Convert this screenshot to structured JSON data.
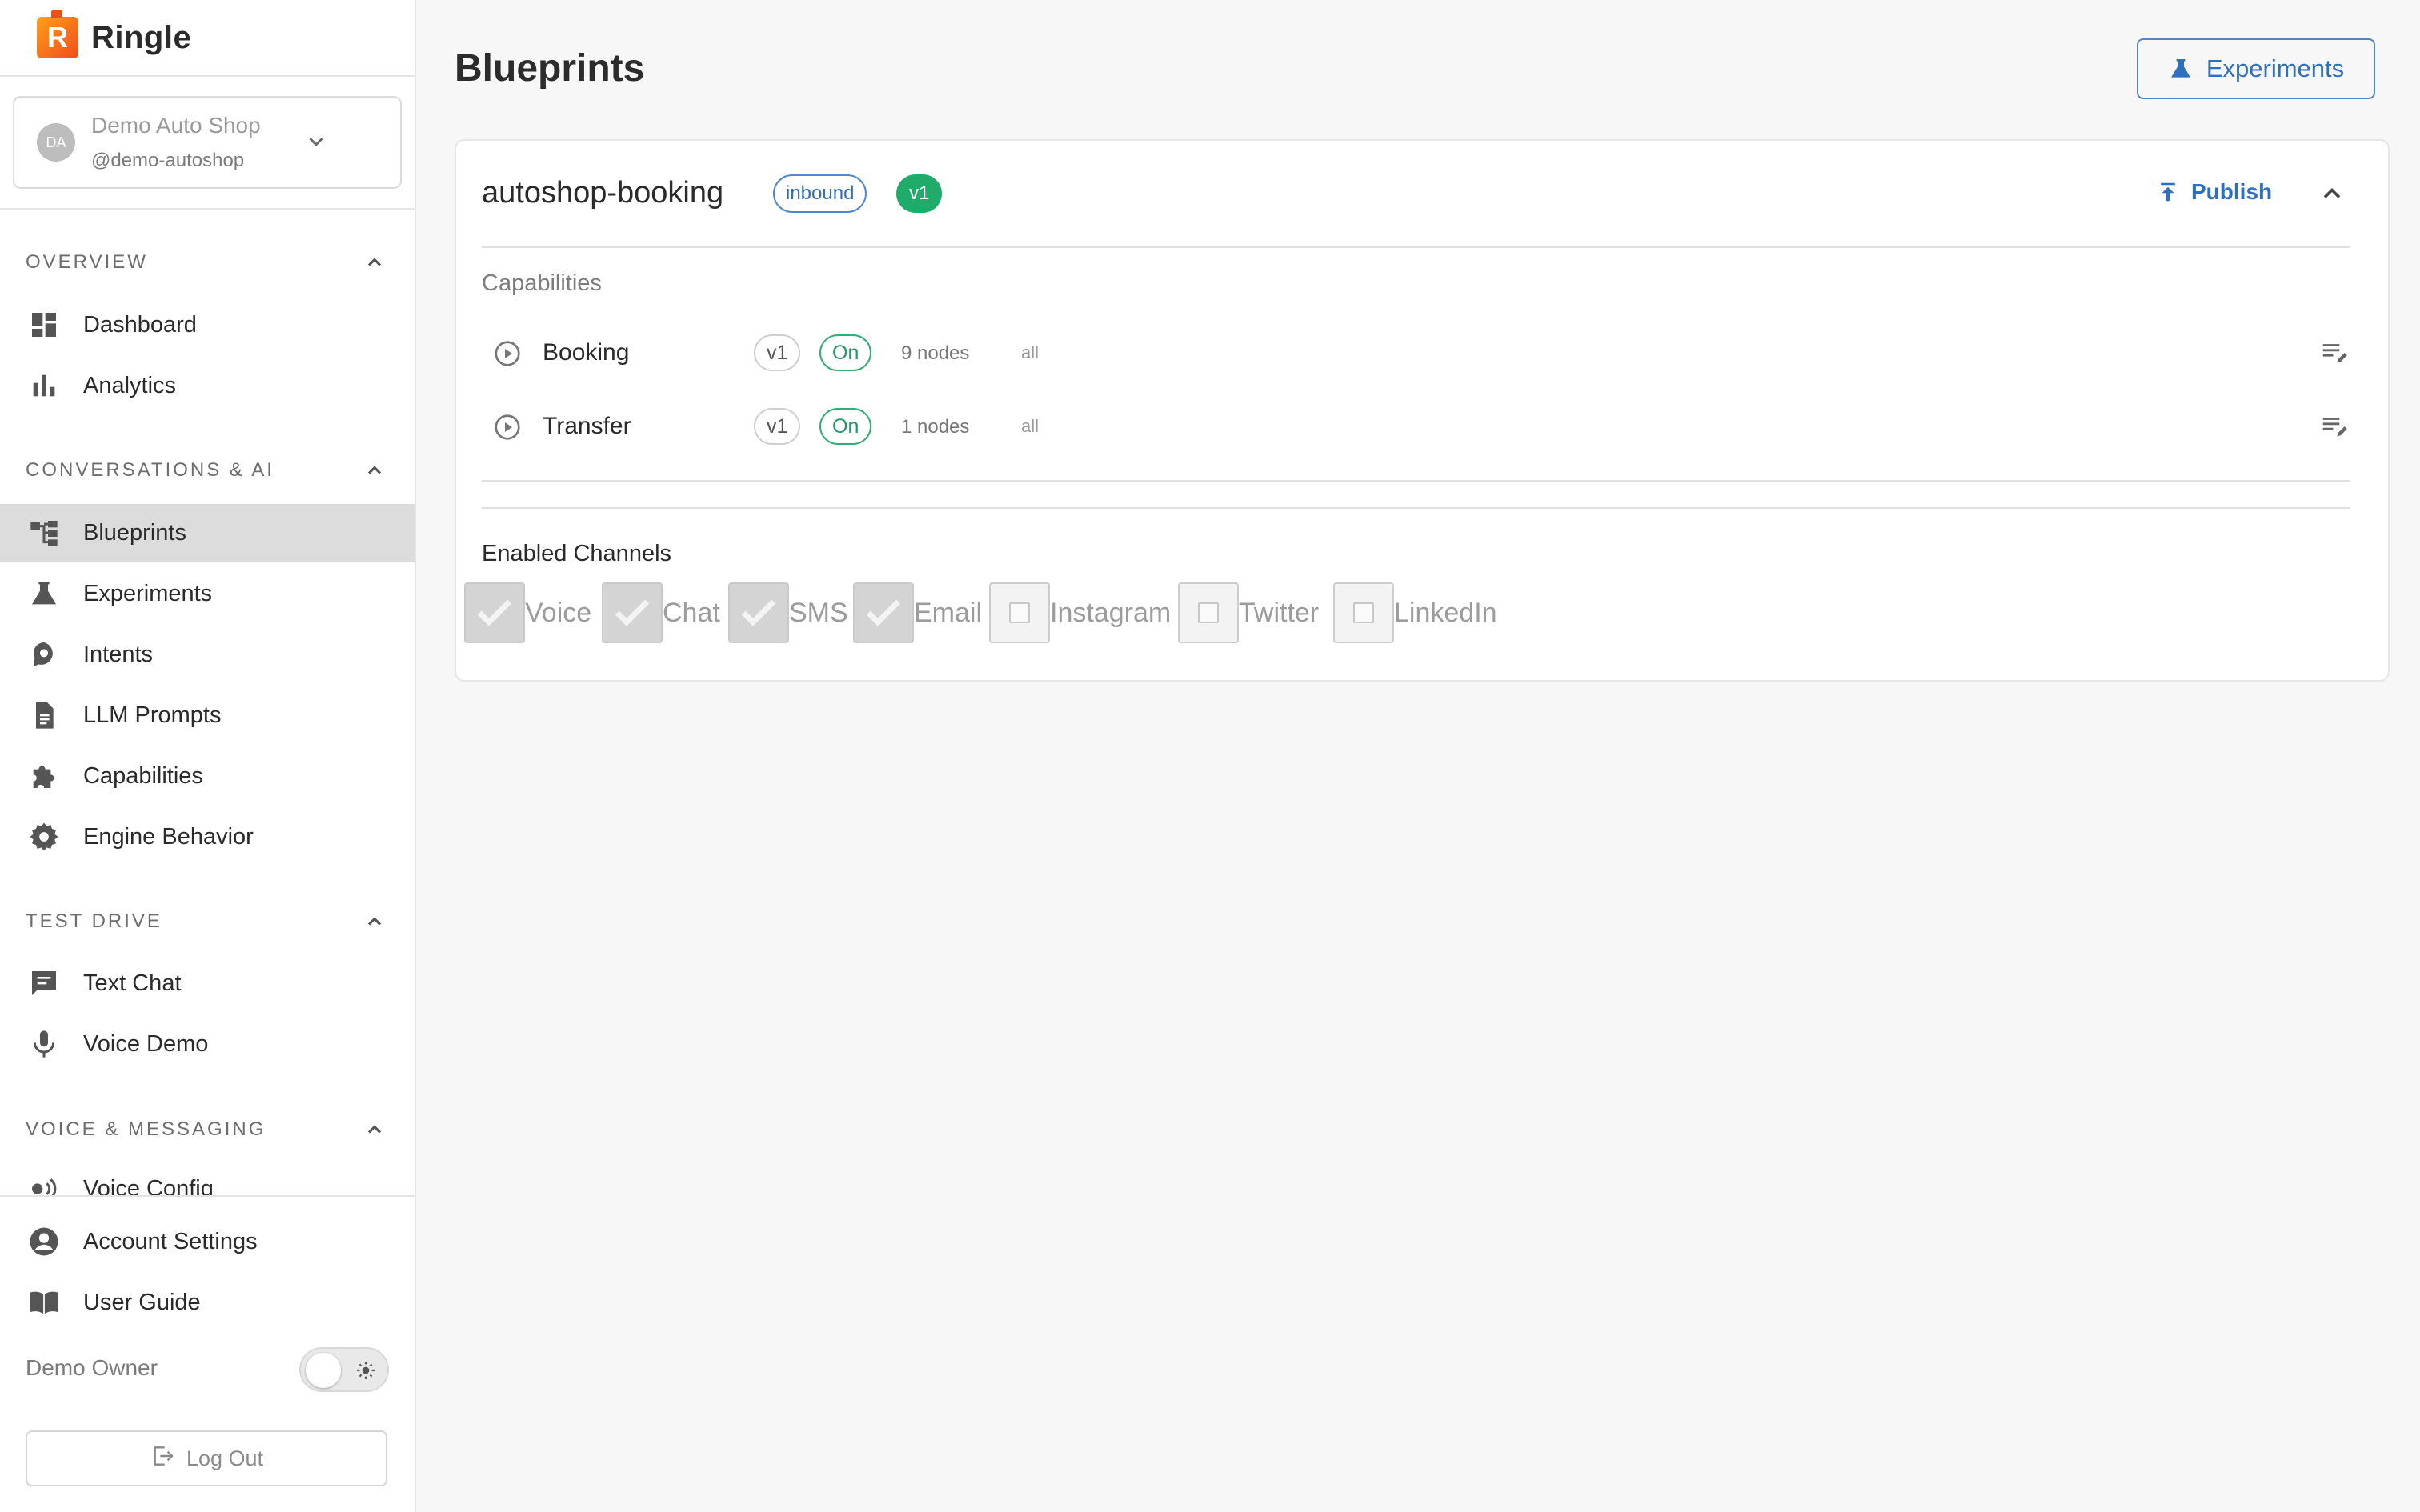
{
  "app": {
    "name": "Ringle",
    "logo_letter": "R"
  },
  "account": {
    "initials": "DA",
    "name": "Demo Auto Shop",
    "handle": "@demo-autoshop"
  },
  "nav": {
    "overview": {
      "title": "OVERVIEW",
      "items": [
        {
          "label": "Dashboard",
          "icon": "dashboard-icon"
        },
        {
          "label": "Analytics",
          "icon": "bar-chart-icon"
        }
      ]
    },
    "conversations": {
      "title": "CONVERSATIONS & AI",
      "items": [
        {
          "label": "Blueprints",
          "icon": "blueprint-icon",
          "active": true
        },
        {
          "label": "Experiments",
          "icon": "flask-icon"
        },
        {
          "label": "Intents",
          "icon": "brain-icon"
        },
        {
          "label": "LLM Prompts",
          "icon": "document-icon"
        },
        {
          "label": "Capabilities",
          "icon": "puzzle-icon"
        },
        {
          "label": "Engine Behavior",
          "icon": "gear-icon"
        }
      ]
    },
    "test_drive": {
      "title": "TEST DRIVE",
      "items": [
        {
          "label": "Text Chat",
          "icon": "chat-icon"
        },
        {
          "label": "Voice Demo",
          "icon": "microphone-icon"
        }
      ]
    },
    "voice_messaging": {
      "title": "VOICE & MESSAGING",
      "items": [
        {
          "label": "Voice Config",
          "icon": "voice-config-icon"
        }
      ]
    }
  },
  "bottom": {
    "account_settings": "Account Settings",
    "user_guide": "User Guide",
    "demo_owner": "Demo Owner",
    "logout": "Log Out"
  },
  "page": {
    "title": "Blueprints",
    "experiments_button": "Experiments"
  },
  "blueprint": {
    "name": "autoshop-booking",
    "direction": "inbound",
    "version": "v1",
    "publish_label": "Publish",
    "capabilities_title": "Capabilities",
    "capabilities": [
      {
        "name": "Booking",
        "version": "v1",
        "status": "On",
        "nodes": "9 nodes",
        "scope": "all"
      },
      {
        "name": "Transfer",
        "version": "v1",
        "status": "On",
        "nodes": "1 nodes",
        "scope": "all"
      }
    ],
    "channels_title": "Enabled Channels",
    "channels": [
      {
        "label": "Voice",
        "checked": true
      },
      {
        "label": "Chat",
        "checked": true
      },
      {
        "label": "SMS",
        "checked": true
      },
      {
        "label": "Email",
        "checked": true
      },
      {
        "label": "Instagram",
        "checked": false
      },
      {
        "label": "Twitter",
        "checked": false
      },
      {
        "label": "LinkedIn",
        "checked": false
      }
    ]
  },
  "colors": {
    "accent_blue": "#2f6fbf",
    "success_green": "#1fab6a",
    "logo_orange": "#ff9f1a",
    "active_nav_bg": "#dcdcdc"
  }
}
